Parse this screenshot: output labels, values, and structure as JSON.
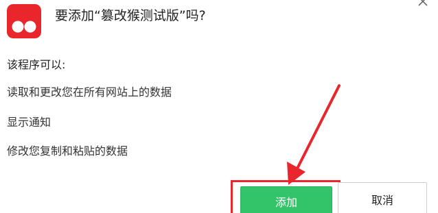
{
  "dialog": {
    "title": "要添加“篡改猴测试版”吗?",
    "permissions_header": "该程序可以:",
    "permissions": [
      "读取和更改您在所有网站上的数据",
      "显示通知",
      "修改您复制和粘贴的数据"
    ],
    "add_label": "添加",
    "cancel_label": "取消"
  },
  "icons": {
    "extension_logo": "tampermonkey-logo-icon",
    "close": "close-icon",
    "annotation_arrow": "red-arrow-icon"
  },
  "colors": {
    "logo_bg": "#e8262b",
    "add_button": "#33c46a",
    "highlight": "#e8262b"
  }
}
